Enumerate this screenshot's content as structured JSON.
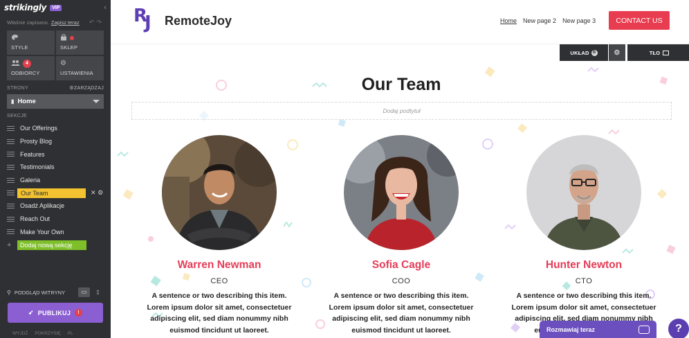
{
  "sidebar": {
    "logo": "strikingly",
    "vip_badge": "VIP",
    "save_status": "Właśnie zapisano.",
    "save_now_link": "Zapisz teraz",
    "tiles": [
      {
        "label": "STYLE",
        "icon": "palette-icon"
      },
      {
        "label": "SKLEP",
        "icon": "shop-icon"
      },
      {
        "label": "ODBIORCY",
        "icon": "people-icon",
        "count": "4"
      },
      {
        "label": "USTAWIENIA",
        "icon": "gear-icon"
      }
    ],
    "pages_label": "STRONY",
    "manage_label": "ZARZĄDZAJ",
    "current_page": "Home",
    "sections_label": "SEKCJE",
    "sections": [
      "Our Offerings",
      "Prosty Blog",
      "Features",
      "Testimonials",
      "Galeria",
      "Our Team",
      "Osadź Aplikacje",
      "Reach Out",
      "Make Your Own"
    ],
    "active_section": "Our Team",
    "add_section": "Dodaj nową sekcję",
    "preview_label": "PODGLĄD WITRYNY",
    "publish_label": "PUBLIKUJ",
    "bottom_items": [
      "WYJDŹ",
      "POKRZYSIĘ",
      "PL"
    ]
  },
  "site": {
    "brand_initials": "RJ",
    "brand_name": "RemoteJoy",
    "nav": [
      "Home",
      "New page 2",
      "New page 3"
    ],
    "contact_label": "CONTACT US",
    "layout_label": "UKŁAD",
    "layout_badge": "B",
    "background_label": "TŁO",
    "section_title": "Our Team",
    "subtitle_placeholder": "Dodaj podtytuł",
    "members": [
      {
        "name": "Warren Newman",
        "role": "CEO",
        "desc": "A sentence or two describing this item. Lorem ipsum dolor sit amet, consectetuer adipiscing elit, sed diam nonummy nibh euismod tincidunt ut laoreet."
      },
      {
        "name": "Sofia Cagle",
        "role": "COO",
        "desc": "A sentence or two describing this item. Lorem ipsum dolor sit amet, consectetuer adipiscing elit, sed diam nonummy nibh euismod tincidunt ut laoreet."
      },
      {
        "name": "Hunter Newton",
        "role": "CTO",
        "desc": "A sentence or two describing this item. Lorem ipsum dolor sit amet, consectetuer adipiscing elit, sed diam nonummy nibh euismod tincidunt ut laoreet."
      }
    ],
    "chat_label": "Rozmawiaj teraz",
    "help_label": "?"
  },
  "colors": {
    "sidebar_bg": "#2f3033",
    "brand_purple": "#5f3fb4",
    "accent_red": "#e83c50",
    "member_name": "#e43d58",
    "active_section": "#f2c230",
    "add_section": "#7fbf2a",
    "publish": "#8b5fd1"
  }
}
